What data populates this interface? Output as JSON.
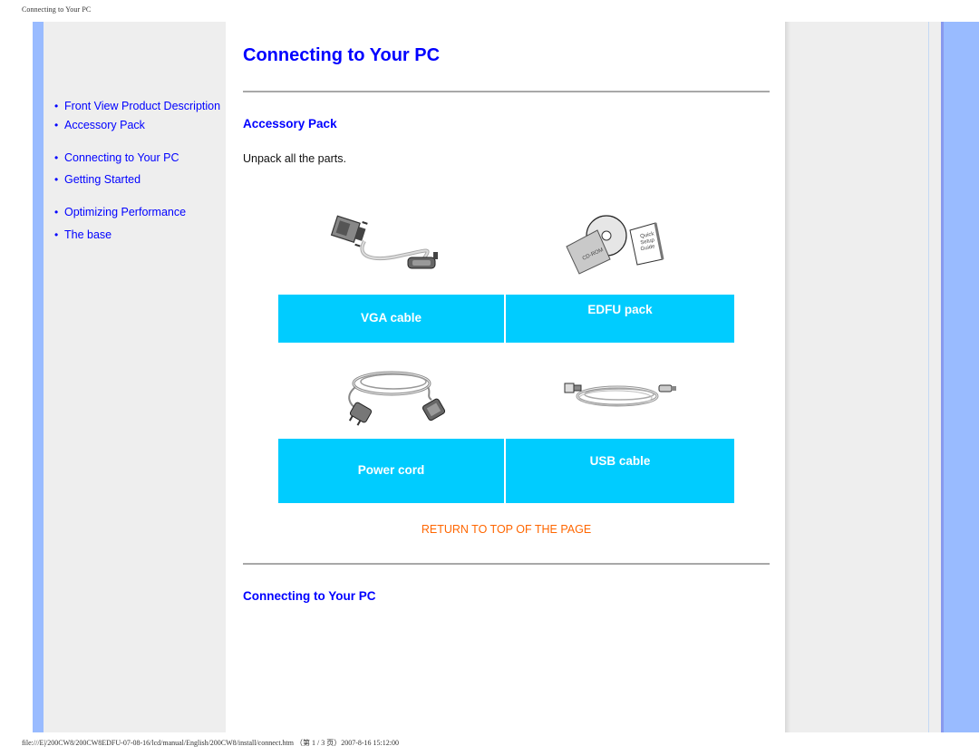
{
  "page_header": "Connecting to Your PC",
  "page_footer": "file:///E|/200CW8/200CW8EDFU-07-08-16/lcd/manual/English/200CW8/install/connect.htm （第 1 / 3 页）2007-8-16 15:12:00",
  "nav": {
    "items": [
      {
        "label": "Front View Product Description"
      },
      {
        "label": "Accessory Pack"
      },
      {
        "label": "Connecting to Your PC"
      },
      {
        "label": "Getting Started"
      },
      {
        "label": "Optimizing Performance"
      },
      {
        "label": "The base"
      }
    ]
  },
  "main": {
    "title": "Connecting to Your PC",
    "section1": {
      "title": "Accessory Pack",
      "intro": "Unpack all the parts."
    },
    "items": [
      {
        "label": "VGA cable",
        "icon": "vga-cable-image"
      },
      {
        "label": "EDFU pack",
        "icon": "cd-and-quick-setup-guide-image"
      },
      {
        "label": "Power cord",
        "icon": "power-cord-image"
      },
      {
        "label": "USB cable",
        "icon": "usb-cable-image"
      }
    ],
    "cd_text": "CD-ROM",
    "guide_text": [
      "Quick",
      "Setup",
      "Guide"
    ],
    "return_link": "RETURN TO TOP OF THE PAGE",
    "section2": {
      "title": "Connecting to Your PC"
    }
  },
  "colors": {
    "link": "#0000ff",
    "accent_cell": "#00ccff",
    "return_link": "#ff6600",
    "side_strip": "#99bbff",
    "panel": "#eeeeee"
  }
}
